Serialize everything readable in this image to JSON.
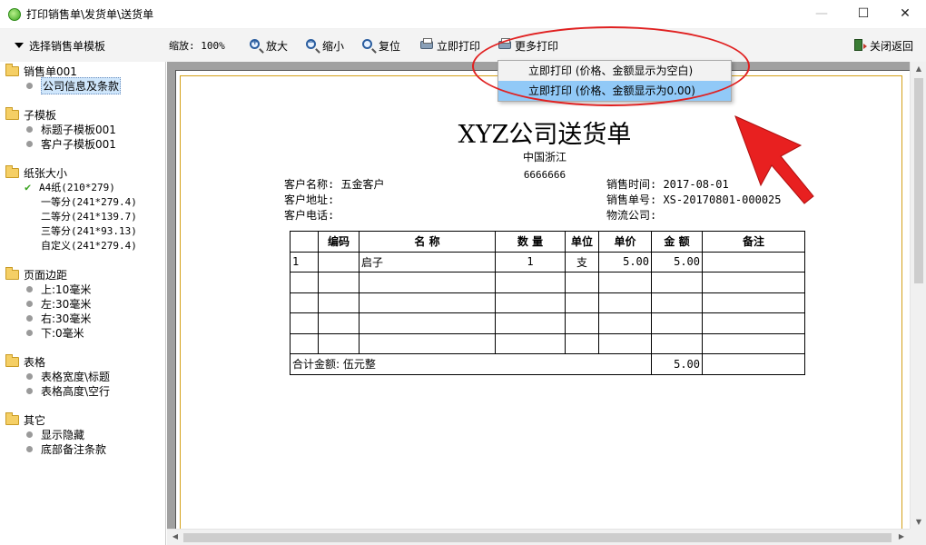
{
  "window": {
    "title": "打印销售单\\发货单\\送货单",
    "controls": {
      "minimize": "—",
      "maximize": "☐",
      "close": "✕"
    }
  },
  "toolbar": {
    "template_select": "选择销售单模板",
    "zoom": "缩放: 100%",
    "zoom_in": "放大",
    "zoom_out": "缩小",
    "reset": "复位",
    "print_now": "立即打印",
    "more_print": "更多打印",
    "close_return": "关闭返回"
  },
  "dropdown": {
    "items": [
      "立即打印 (价格、金额显示为空白)",
      "立即打印 (价格、金额显示为0.00)"
    ],
    "hovered_index": 1
  },
  "tree": {
    "groups": [
      {
        "label": "销售单001",
        "items": [
          {
            "label": "公司信息及条款",
            "selected": true
          }
        ]
      },
      {
        "label": "子模板",
        "items": [
          {
            "label": "标题子模板001"
          },
          {
            "label": "客户子模板001"
          }
        ]
      },
      {
        "label": "纸张大小",
        "items": [
          {
            "label": "A4纸(210*279)",
            "checked": true
          },
          {
            "label": "一等分(241*279.4)"
          },
          {
            "label": "二等分(241*139.7)"
          },
          {
            "label": "三等分(241*93.13)"
          },
          {
            "label": "自定义(241*279.4)"
          }
        ]
      },
      {
        "label": "页面边距",
        "items": [
          {
            "label": "上:10毫米"
          },
          {
            "label": "左:30毫米"
          },
          {
            "label": "右:30毫米"
          },
          {
            "label": "下:0毫米"
          }
        ]
      },
      {
        "label": "表格",
        "items": [
          {
            "label": "表格宽度\\标题"
          },
          {
            "label": "表格高度\\空行"
          }
        ]
      },
      {
        "label": "其它",
        "items": [
          {
            "label": "显示隐藏"
          },
          {
            "label": "底部备注条款"
          }
        ]
      }
    ]
  },
  "document": {
    "title": "XYZ公司送货单",
    "subtitle": "中国浙江",
    "phone": "6666666",
    "customer_name": "客户名称: 五金客户",
    "customer_address": "客户地址:",
    "customer_phone": "客户电话:",
    "sale_time": "销售时间: 2017-08-01",
    "sale_no": "销售单号: XS-20170801-000025",
    "logistics": "物流公司:",
    "table": {
      "headers": [
        "",
        "编码",
        "名 称",
        "数 量",
        "单位",
        "单价",
        "金 额",
        "备注"
      ],
      "rows": [
        [
          "1",
          "",
          "启子",
          "1",
          "支",
          "5.00",
          "5.00",
          ""
        ],
        [
          "",
          "",
          "",
          "",
          "",
          "",
          "",
          ""
        ],
        [
          "",
          "",
          "",
          "",
          "",
          "",
          "",
          ""
        ],
        [
          "",
          "",
          "",
          "",
          "",
          "",
          "",
          ""
        ],
        [
          "",
          "",
          "",
          "",
          "",
          "",
          "",
          ""
        ]
      ],
      "total_label": "合计金额: 伍元整",
      "total_value": "5.00"
    }
  },
  "colors": {
    "annotation": "#e02020",
    "menu_hover": "#91c9f7",
    "paper_margin": "#d4a017"
  }
}
